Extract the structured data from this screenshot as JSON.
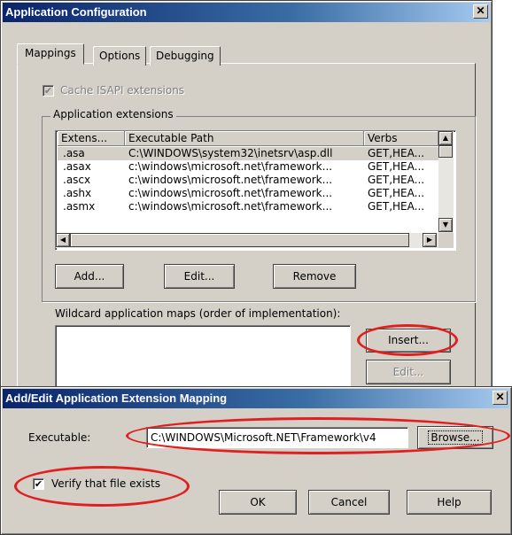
{
  "app_config": {
    "title": "Application Configuration",
    "close_glyph": "✕",
    "tabs": [
      {
        "label": "Mappings"
      },
      {
        "label": "Options"
      },
      {
        "label": "Debugging"
      }
    ],
    "cache_isapi_label": "Cache ISAPI extensions",
    "cache_isapi_checked": true,
    "app_extensions_group": "Application extensions",
    "columns": [
      "Extens...",
      "Executable Path",
      "Verbs"
    ],
    "rows": [
      {
        "ext": ".asa",
        "path": "C:\\WINDOWS\\system32\\inetsrv\\asp.dll",
        "verbs": "GET,HEA..."
      },
      {
        "ext": ".asax",
        "path": "c:\\windows\\microsoft.net\\framework...",
        "verbs": "GET,HEA..."
      },
      {
        "ext": ".ascx",
        "path": "c:\\windows\\microsoft.net\\framework...",
        "verbs": "GET,HEA..."
      },
      {
        "ext": ".ashx",
        "path": "c:\\windows\\microsoft.net\\framework...",
        "verbs": "GET,HEA..."
      },
      {
        "ext": ".asmx",
        "path": "c:\\windows\\microsoft.net\\framework...",
        "verbs": "GET,HEA..."
      }
    ],
    "add_label": "Add...",
    "edit_label": "Edit...",
    "remove_label": "Remove",
    "wildcard_label": "Wildcard application maps (order of implementation):",
    "insert_label": "Insert...",
    "wild_edit_label": "Edit..."
  },
  "mapping_dialog": {
    "title": "Add/Edit Application Extension Mapping",
    "close_glyph": "✕",
    "executable_label": "Executable:",
    "executable_value": "C:\\WINDOWS\\Microsoft.NET\\Framework\\v4",
    "browse_label": "Browse...",
    "verify_label": "Verify that file exists",
    "verify_checked": true,
    "check_glyph": "✔",
    "ok_label": "OK",
    "cancel_label": "Cancel",
    "help_label": "Help"
  },
  "annotation_color": "#e02020"
}
